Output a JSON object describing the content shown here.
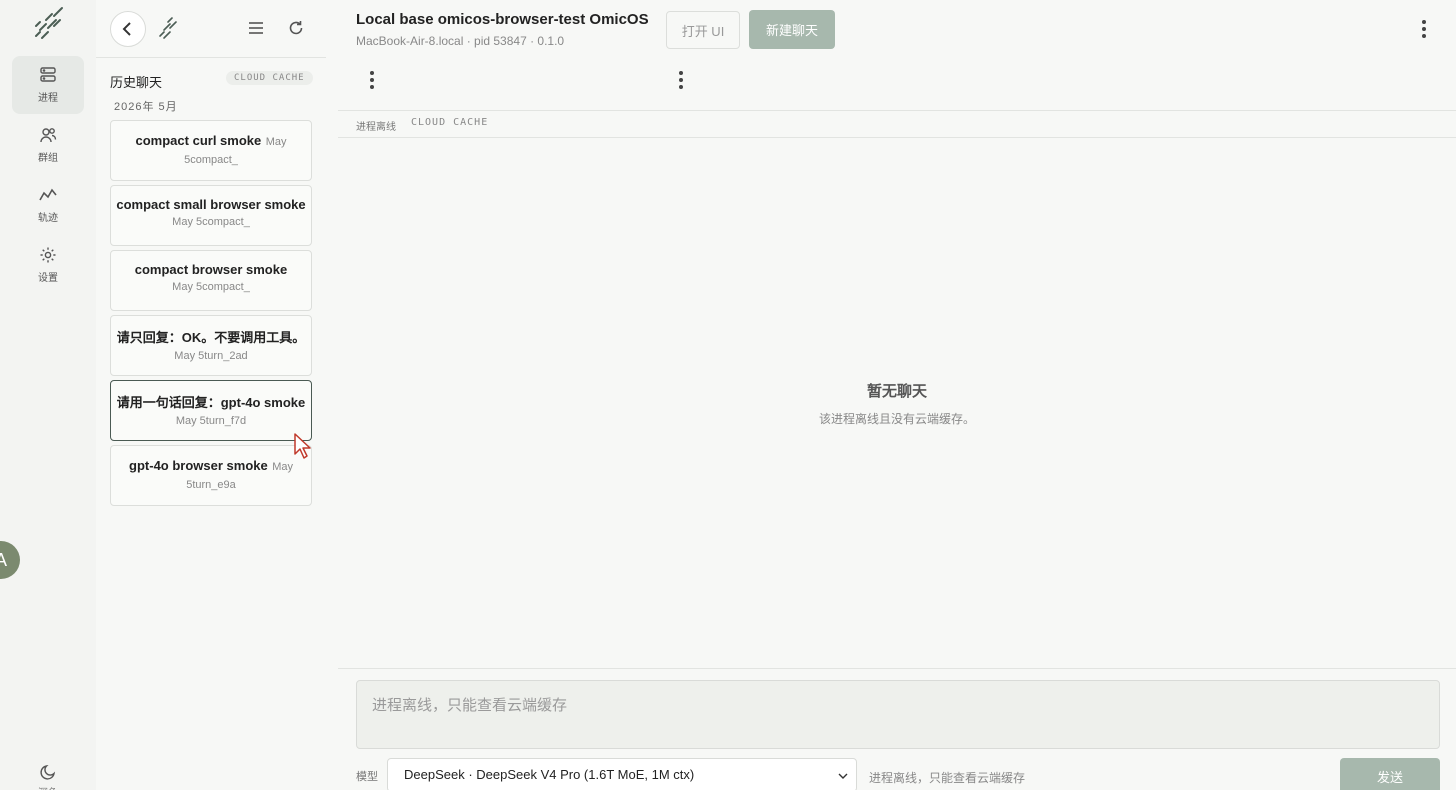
{
  "nav": {
    "items": [
      {
        "label": "进程",
        "icon": "server-icon",
        "active": true
      },
      {
        "label": "群组",
        "icon": "users-icon",
        "active": false
      },
      {
        "label": "轨迹",
        "icon": "trajectory-icon",
        "active": false
      },
      {
        "label": "设置",
        "icon": "gear-icon",
        "active": false
      }
    ],
    "avatar_letter": "A",
    "theme_label": "深色"
  },
  "history": {
    "title": "历史聊天",
    "badge": "CLOUD CACHE",
    "date_group": "2026年 5月",
    "chats": [
      {
        "title": "compact curl smoke",
        "date": "May",
        "sub": "5compact_"
      },
      {
        "title": "compact small browser smoke",
        "date": "",
        "sub": "May 5compact_"
      },
      {
        "title": "compact browser smoke",
        "date": "",
        "sub": "May 5compact_"
      },
      {
        "title": "请只回复：OK。不要调用工具。",
        "date": "",
        "sub": "May 5turn_2ad"
      },
      {
        "title": "请用一句话回复：gpt-4o smoke",
        "date": "",
        "sub": "May 5turn_f7d"
      },
      {
        "title": "gpt-4o browser smoke",
        "date": "May",
        "sub": "5turn_e9a"
      }
    ]
  },
  "header": {
    "title": "Local base omicos-browser-test OmicOS",
    "subtitle": "MacBook-Air-8.local · pid 53847 · 0.1.0",
    "open_ui_label": "打开 UI",
    "new_chat_label": "新建聊天"
  },
  "strip": {
    "status": "进程离线",
    "cloud": "CLOUD CACHE"
  },
  "empty": {
    "title": "暂无聊天",
    "subtitle": "该进程离线且没有云端缓存。"
  },
  "composer": {
    "placeholder": "进程离线，只能查看云端缓存",
    "model_label": "模型",
    "model_value": "DeepSeek · DeepSeek V4 Pro (1.6T MoE, 1M ctx)",
    "note": "进程离线，只能查看云端缓存",
    "send_label": "发送"
  },
  "colors": {
    "accent": "#a7b8ad",
    "selected_border": "#4a5a53"
  }
}
